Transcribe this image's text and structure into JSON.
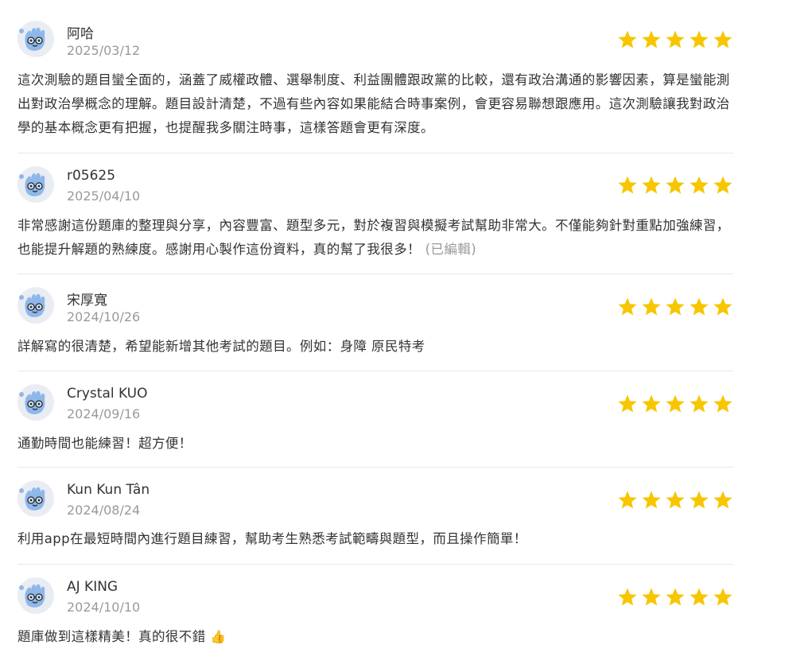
{
  "reviews": [
    {
      "name": "阿哈",
      "date": "2025/03/12",
      "rating": 5,
      "text": "這次測驗的題目蠻全面的，涵蓋了威權政體、選舉制度、利益團體跟政黨的比較，還有政治溝通的影響因素，算是蠻能測出對政治學概念的理解。題目設計清楚，不過有些內容如果能結合時事案例，會更容易聯想跟應用。這次測驗讓我對政治學的基本概念更有把握，也提醒我多關注時事，這樣答題會更有深度。"
    },
    {
      "name": "r05625",
      "date": "2025/04/10",
      "rating": 5,
      "text": "非常感謝這份題庫的整理與分享，內容豐富、題型多元，對於複習與模擬考試幫助非常大。不僅能夠針對重點加強練習，也能提升解題的熟練度。感謝用心製作這份資料，真的幫了我很多！",
      "edited_label": "(已編輯)"
    },
    {
      "name": "宋厚寬",
      "date": "2024/10/26",
      "rating": 5,
      "text": "詳解寫的很清楚，希望能新增其他考試的題目。例如：身障 原民特考"
    },
    {
      "name": "Crystal KUO",
      "date": "2024/09/16",
      "rating": 5,
      "text": "通勤時間也能練習！超方便！"
    },
    {
      "name": "Kun Kun Tân",
      "date": "2024/08/24",
      "rating": 5,
      "text": "利用app在最短時間內進行題目練習，幫助考生熟悉考試範疇與題型，而且操作簡單！"
    },
    {
      "name": "AJ KING",
      "date": "2024/10/10",
      "rating": 5,
      "text": "題庫做到這樣精美！真的很不錯",
      "emoji": "👍"
    }
  ],
  "colors": {
    "star": "#f7c600",
    "avatar_bg": "#e9edf3",
    "avatar_hand": "#8fb7ea",
    "avatar_dark": "#2b3a4a",
    "divider": "#e8e8e8",
    "date": "#9a9a9a"
  },
  "icons": {
    "avatar": "blue-hand-mascot-icon",
    "rating": "star-icon"
  }
}
